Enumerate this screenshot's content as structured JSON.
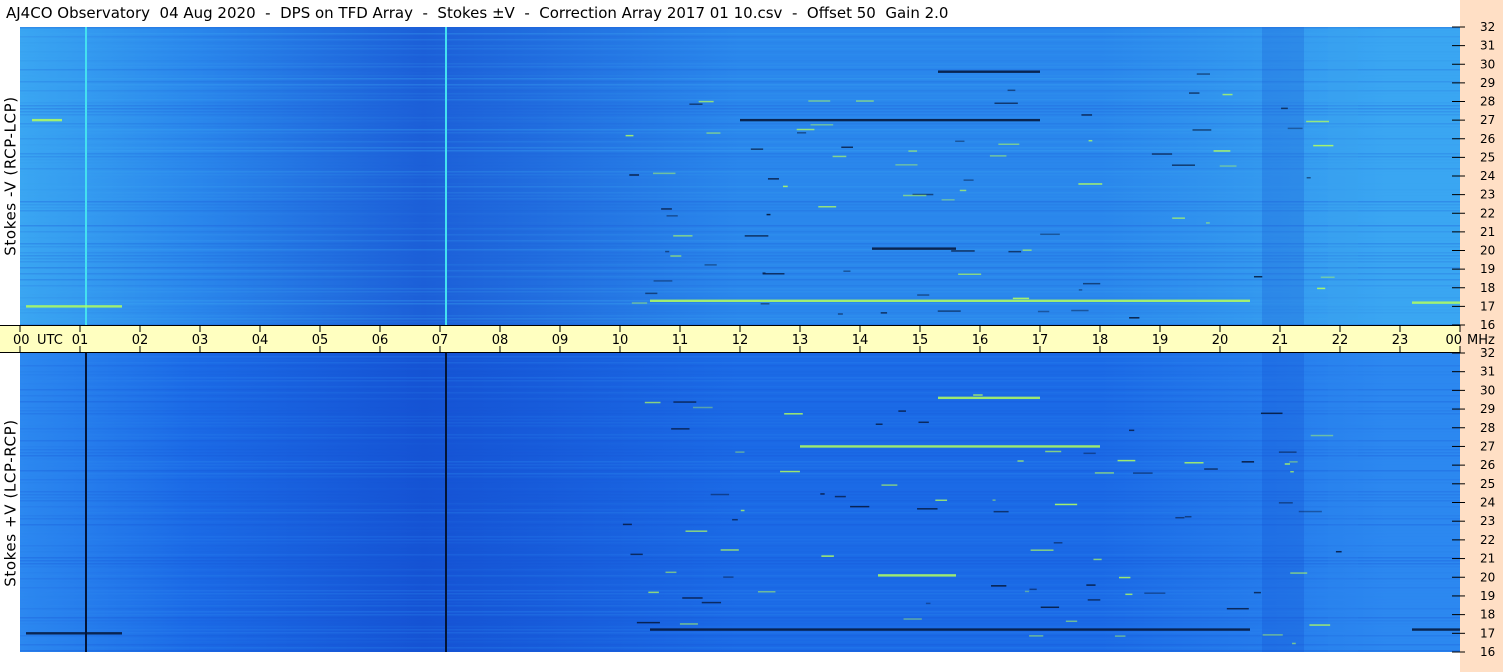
{
  "header": {
    "title": "AJ4CO Observatory  04 Aug 2020  -  DPS on TFD Array  -  Stokes ±V  -  Correction Array 2017 01 10.csv  -  Offset 50  Gain 2.0"
  },
  "chart_data": [
    {
      "type": "heatmap",
      "title": "Stokes -V (RCP-LCP)",
      "xlabel": "UTC",
      "ylabel": "MHz",
      "xlim": [
        0,
        24
      ],
      "ylim": [
        16,
        32
      ],
      "x_ticks": [
        "00",
        "01",
        "02",
        "03",
        "04",
        "05",
        "06",
        "07",
        "08",
        "09",
        "10",
        "11",
        "12",
        "13",
        "14",
        "15",
        "16",
        "17",
        "18",
        "19",
        "20",
        "21",
        "22",
        "23",
        "00"
      ],
      "y_ticks": [
        "16",
        "17",
        "18",
        "19",
        "20",
        "21",
        "22",
        "23",
        "24",
        "25",
        "26",
        "27",
        "28",
        "29",
        "30",
        "31",
        "32"
      ],
      "colors": {
        "base": "#2a87ec",
        "dark": "#1c5fd8",
        "light": "#3aa6f2",
        "bright": "#b4ff5c",
        "black": "#041436",
        "line": "#44e0f0"
      },
      "vertical_lines": [
        {
          "x": 1.1,
          "color": "#44e0f0"
        },
        {
          "x": 7.1,
          "color": "#44e0f0"
        }
      ],
      "features": [
        {
          "x_start": 0.1,
          "x_end": 1.7,
          "freq_mhz": 17.0,
          "color": "#b4ff5c"
        },
        {
          "x_start": 0.2,
          "x_end": 0.7,
          "freq_mhz": 27.0,
          "color": "#b4ff5c"
        },
        {
          "x_start": 10.5,
          "x_end": 20.5,
          "freq_mhz": 17.3,
          "color": "#b4ff5c"
        },
        {
          "x_start": 12.0,
          "x_end": 17.0,
          "freq_mhz": 27.0,
          "color": "#041436"
        },
        {
          "x_start": 15.3,
          "x_end": 17.0,
          "freq_mhz": 29.6,
          "color": "#041436"
        },
        {
          "x_start": 14.2,
          "x_end": 15.6,
          "freq_mhz": 20.1,
          "color": "#041436"
        },
        {
          "x_start": 23.2,
          "x_end": 24.0,
          "freq_mhz": 17.2,
          "color": "#b4ff5c"
        }
      ]
    },
    {
      "type": "heatmap",
      "title": "Stokes +V (LCP-RCP)",
      "xlabel": "UTC",
      "ylabel": "MHz",
      "xlim": [
        0,
        24
      ],
      "ylim": [
        16,
        32
      ],
      "x_ticks": [
        "00",
        "01",
        "02",
        "03",
        "04",
        "05",
        "06",
        "07",
        "08",
        "09",
        "10",
        "11",
        "12",
        "13",
        "14",
        "15",
        "16",
        "17",
        "18",
        "19",
        "20",
        "21",
        "22",
        "23",
        "00"
      ],
      "y_ticks": [
        "16",
        "17",
        "18",
        "19",
        "20",
        "21",
        "22",
        "23",
        "24",
        "25",
        "26",
        "27",
        "28",
        "29",
        "30",
        "31",
        "32"
      ],
      "colors": {
        "base": "#1b6ae6",
        "dark": "#1553d4",
        "light": "#2c88f0",
        "bright": "#b4ff5c",
        "black": "#041436",
        "line": "#061a50"
      },
      "vertical_lines": [
        {
          "x": 1.1,
          "color": "#041436"
        },
        {
          "x": 7.1,
          "color": "#041436"
        }
      ],
      "features": [
        {
          "x_start": 0.1,
          "x_end": 1.7,
          "freq_mhz": 17.0,
          "color": "#041436"
        },
        {
          "x_start": 13.0,
          "x_end": 18.0,
          "freq_mhz": 27.0,
          "color": "#b4ff5c"
        },
        {
          "x_start": 10.5,
          "x_end": 20.5,
          "freq_mhz": 17.2,
          "color": "#041436"
        },
        {
          "x_start": 14.3,
          "x_end": 15.6,
          "freq_mhz": 20.1,
          "color": "#b4ff5c"
        },
        {
          "x_start": 15.3,
          "x_end": 17.0,
          "freq_mhz": 29.6,
          "color": "#b4ff5c"
        },
        {
          "x_start": 23.2,
          "x_end": 24.0,
          "freq_mhz": 17.2,
          "color": "#041436"
        }
      ]
    }
  ],
  "axis": {
    "x_unit": "UTC",
    "y_unit": "MHz"
  }
}
